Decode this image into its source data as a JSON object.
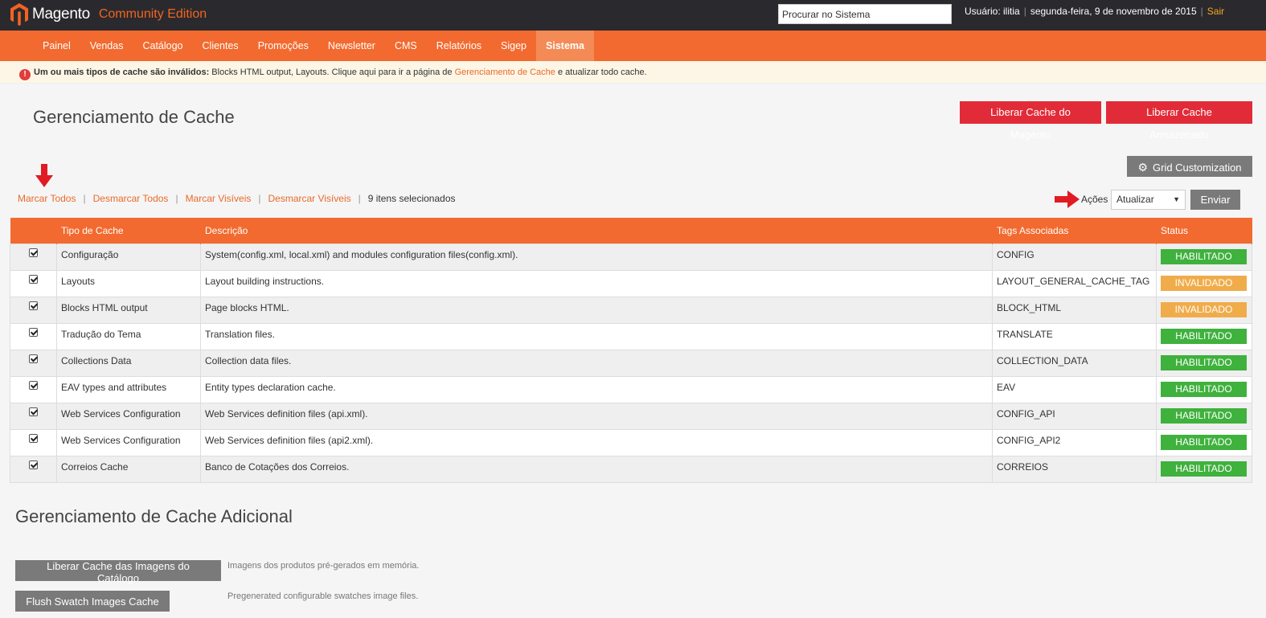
{
  "header": {
    "brand": "Magento",
    "edition": "Community Edition",
    "search_placeholder": "Procurar no Sistema",
    "user": "Usuário: ilitia",
    "date": "segunda-feira, 9 de novembro de 2015",
    "logout": "Sair",
    "brand_color": "#f26322"
  },
  "nav": {
    "items": [
      {
        "label": "Painel"
      },
      {
        "label": "Vendas"
      },
      {
        "label": "Catálogo"
      },
      {
        "label": "Clientes"
      },
      {
        "label": "Promoções"
      },
      {
        "label": "Newsletter"
      },
      {
        "label": "CMS"
      },
      {
        "label": "Relatórios"
      },
      {
        "label": "Sigep"
      },
      {
        "label": "Sistema",
        "active": true
      }
    ]
  },
  "notice": {
    "bold": "Um ou mais tipos de cache são inválidos:",
    "text1": " Blocks HTML output, Layouts. Clique aqui para ir a página de ",
    "link": "Gerenciamento de Cache",
    "text2": " e atualizar todo cache."
  },
  "page": {
    "title": "Gerenciamento de Cache",
    "flush_magento": "Liberar Cache do Magento",
    "flush_storage": "Liberar Cache Armazenado",
    "grid_customization": "Grid Customization"
  },
  "massaction": {
    "select_all": "Marcar Todos",
    "unselect_all": "Desmarcar Todos",
    "select_visible": "Marcar Visíveis",
    "unselect_visible": "Desmarcar Visíveis",
    "selected_count": "9 itens selecionados",
    "actions_label": "Ações",
    "action_value": "Atualizar",
    "submit": "Enviar"
  },
  "grid": {
    "columns": [
      "",
      "Tipo de Cache",
      "Descrição",
      "Tags Associadas",
      "Status"
    ],
    "rows": [
      {
        "type": "Configuração",
        "desc": "System(config.xml, local.xml) and modules configuration files(config.xml).",
        "tags": "CONFIG",
        "status": "HABILITADO",
        "state": "ok"
      },
      {
        "type": "Layouts",
        "desc": "Layout building instructions.",
        "tags": "LAYOUT_GENERAL_CACHE_TAG",
        "status": "INVALIDADO",
        "state": "inv"
      },
      {
        "type": "Blocks HTML output",
        "desc": "Page blocks HTML.",
        "tags": "BLOCK_HTML",
        "status": "INVALIDADO",
        "state": "inv"
      },
      {
        "type": "Tradução do Tema",
        "desc": "Translation files.",
        "tags": "TRANSLATE",
        "status": "HABILITADO",
        "state": "ok"
      },
      {
        "type": "Collections Data",
        "desc": "Collection data files.",
        "tags": "COLLECTION_DATA",
        "status": "HABILITADO",
        "state": "ok"
      },
      {
        "type": "EAV types and attributes",
        "desc": "Entity types declaration cache.",
        "tags": "EAV",
        "status": "HABILITADO",
        "state": "ok"
      },
      {
        "type": "Web Services Configuration",
        "desc": "Web Services definition files (api.xml).",
        "tags": "CONFIG_API",
        "status": "HABILITADO",
        "state": "ok"
      },
      {
        "type": "Web Services Configuration",
        "desc": "Web Services definition files (api2.xml).",
        "tags": "CONFIG_API2",
        "status": "HABILITADO",
        "state": "ok"
      },
      {
        "type": "Correios Cache",
        "desc": "Banco de Cotações dos Correios.",
        "tags": "CORREIOS",
        "status": "HABILITADO",
        "state": "ok"
      }
    ],
    "status_colors": {
      "ok": "#3fb13d",
      "inv": "#f0ac4a"
    }
  },
  "additional": {
    "title": "Gerenciamento de Cache Adicional",
    "catalog_button": "Liberar Cache das Imagens do Catálogo",
    "catalog_desc": "Imagens dos produtos pré-gerados em memória.",
    "swatch_button": "Flush Swatch Images Cache",
    "swatch_desc": "Pregenerated configurable swatches image files."
  }
}
